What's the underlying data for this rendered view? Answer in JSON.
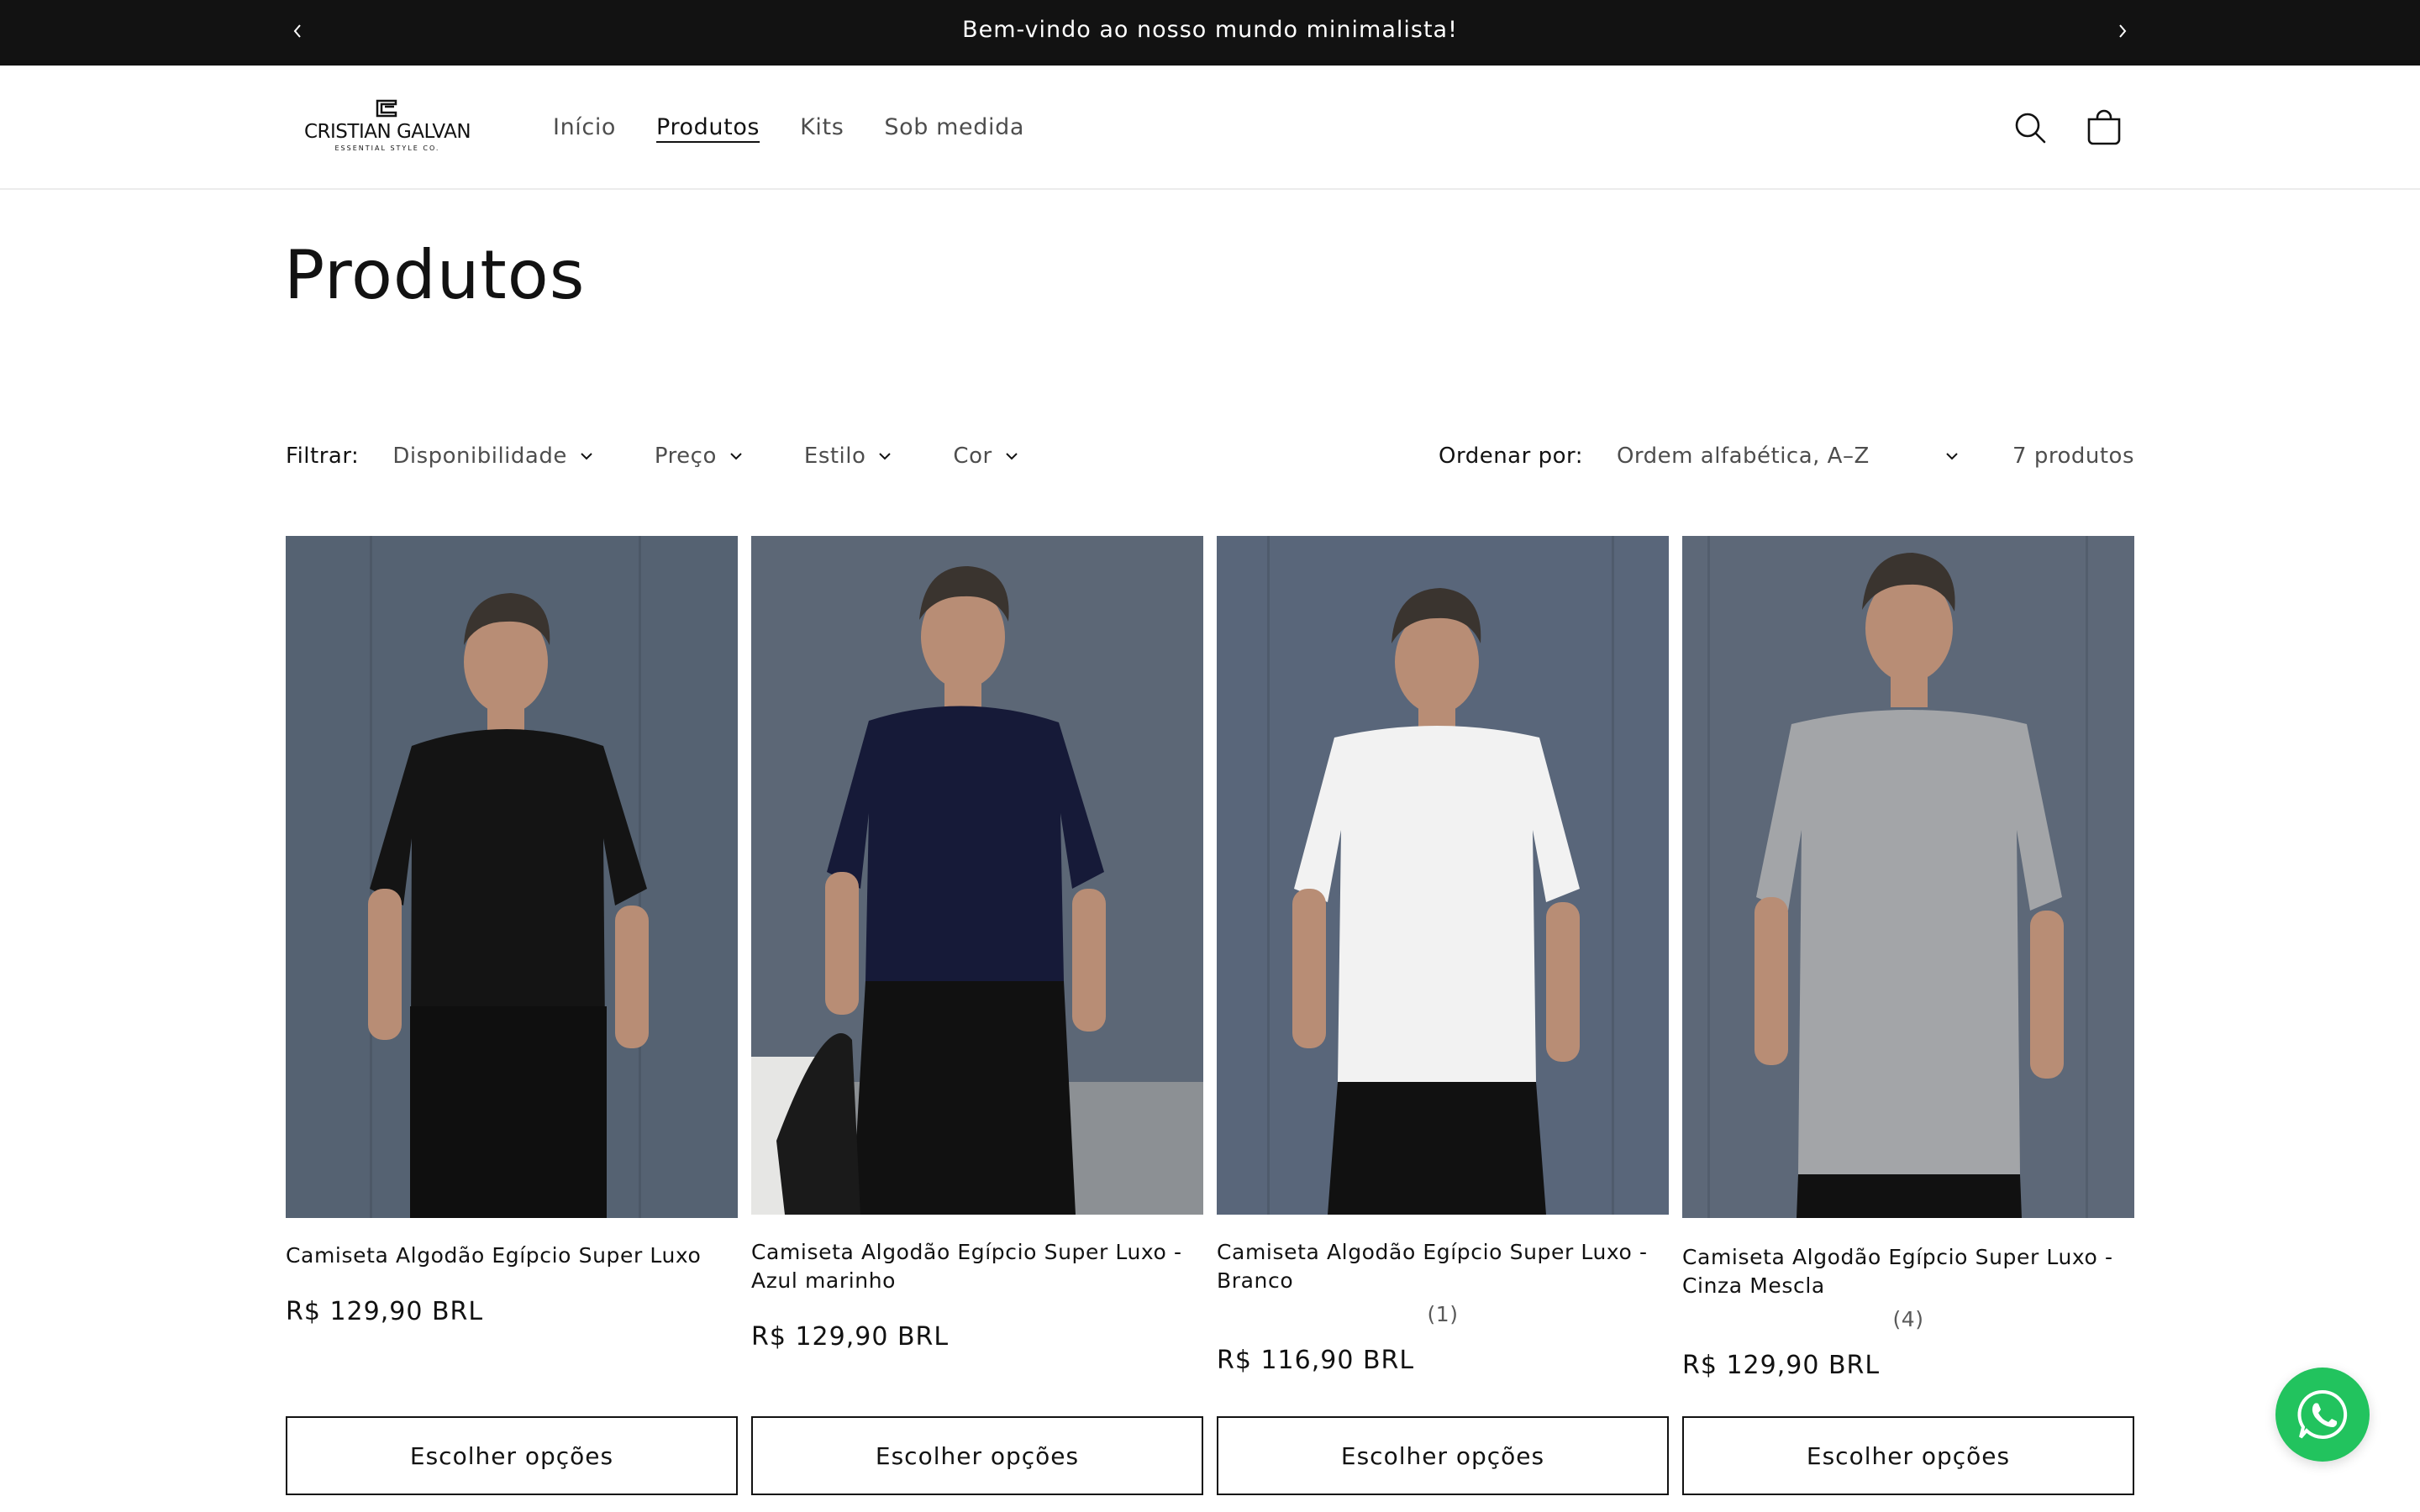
{
  "announcement": {
    "message": "Bem-vindo ao nosso mundo minimalista!",
    "prev_icon": "chevron-left-icon",
    "next_icon": "chevron-right-icon"
  },
  "header": {
    "logo_name": "CRISTIAN GALVAN",
    "logo_tagline": "ESSENTIAL STYLE CO.",
    "nav": [
      {
        "label": "Início",
        "active": false
      },
      {
        "label": "Produtos",
        "active": true
      },
      {
        "label": "Kits",
        "active": false
      },
      {
        "label": "Sob medida",
        "active": false
      }
    ],
    "search_icon": "search-icon",
    "cart_icon": "cart-icon"
  },
  "page": {
    "title": "Produtos"
  },
  "filters": {
    "label": "Filtrar:",
    "items": [
      "Disponibilidade",
      "Preço",
      "Estilo",
      "Cor"
    ],
    "sort_label": "Ordenar por:",
    "sort_value": "Ordem alfabética, A–Z",
    "count": "7 produtos"
  },
  "products": [
    {
      "title": "Camiseta Algodão Egípcio Super Luxo",
      "rating": "",
      "price": "R$ 129,90 BRL",
      "button": "Escolher opções",
      "shirt_color": "#141414"
    },
    {
      "title": "Camiseta Algodão Egípcio Super Luxo - Azul marinho",
      "rating": "",
      "price": "R$ 129,90 BRL",
      "button": "Escolher opções",
      "shirt_color": "#161a38"
    },
    {
      "title": "Camiseta Algodão Egípcio Super Luxo - Branco",
      "rating": "(1)",
      "price": "R$ 116,90 BRL",
      "button": "Escolher opções",
      "shirt_color": "#f2f2f2"
    },
    {
      "title": "Camiseta Algodão Egípcio Super Luxo - Cinza Mescla",
      "rating": "(4)",
      "price": "R$ 129,90 BRL",
      "button": "Escolher opções",
      "shirt_color": "#a3a5a8"
    }
  ],
  "colors": {
    "announcement_bg": "#121212",
    "whatsapp": "#22c35e",
    "photo_bg": "#566373"
  },
  "whatsapp_icon": "whatsapp-icon"
}
